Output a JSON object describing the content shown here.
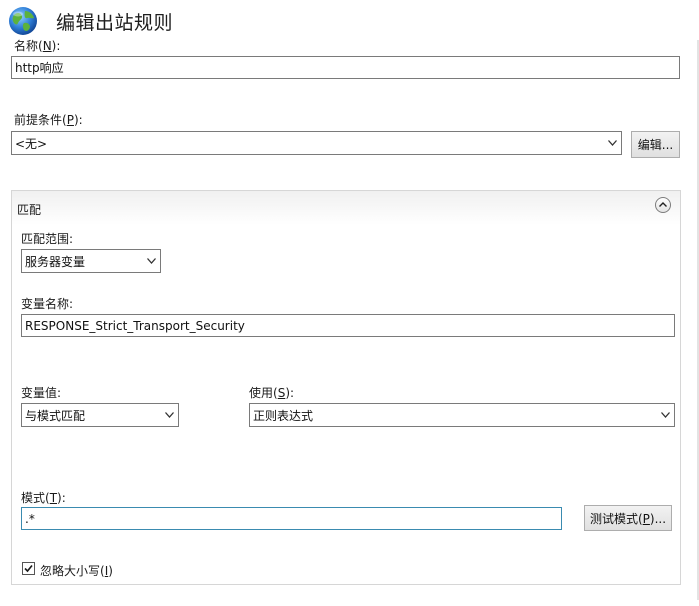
{
  "window": {
    "title": "编辑出站规则",
    "icon": "globe-icon"
  },
  "name_field": {
    "label_pre": "名称(",
    "label_key": "N",
    "label_post": "):",
    "value": "http响应"
  },
  "precondition": {
    "label_pre": "前提条件(",
    "label_key": "P",
    "label_post": "):",
    "selected": "<无>",
    "edit_button": "编辑..."
  },
  "match_section": {
    "title": "匹配",
    "scope": {
      "label": "匹配范围:",
      "selected": "服务器变量"
    },
    "variable_name": {
      "label": "变量名称:",
      "value": "RESPONSE_Strict_Transport_Security"
    },
    "variable_value": {
      "label": "变量值:",
      "selected": "与模式匹配"
    },
    "using": {
      "label_pre": "使用(",
      "label_key": "S",
      "label_post": "):",
      "selected": "正则表达式"
    },
    "pattern": {
      "label_pre": "模式(",
      "label_key": "T",
      "label_post": "):",
      "value": ".*",
      "test_button": {
        "pre": "测试模式(",
        "key": "P",
        "post": ")..."
      }
    },
    "ignore_case": {
      "label_pre": "忽略大小写(",
      "label_key": "I",
      "label_post": ")",
      "checked": true
    }
  },
  "colors": {
    "focus_border": "#3a8bb0",
    "border": "#7a7a7a",
    "section_border": "#d6d6d6"
  }
}
